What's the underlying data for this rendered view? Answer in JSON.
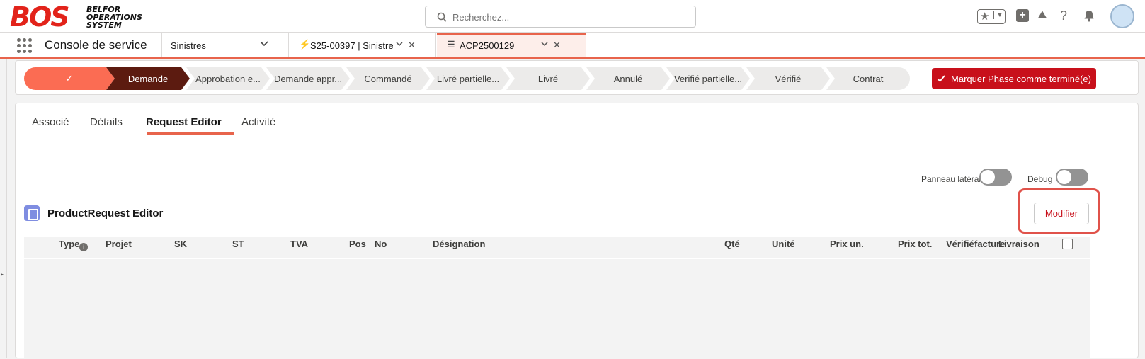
{
  "header": {
    "logo_text": "BOS",
    "logo_subtitle": "BELFOR OPERATIONS SYSTEM",
    "search_placeholder": "Recherchez...",
    "icons": [
      "star-icon",
      "plus-icon",
      "trailhead-icon",
      "help-icon",
      "bell-icon",
      "avatar"
    ]
  },
  "nav": {
    "app_name": "Console de service",
    "object_selector": "Sinistres",
    "tabs": [
      {
        "label": "S25-00397 | Sinistre",
        "icon": "bolt-icon",
        "active": false
      },
      {
        "label": "ACP2500129",
        "icon": "request-icon",
        "active": true
      }
    ]
  },
  "path": {
    "steps": [
      {
        "label": "✓",
        "state": "complete"
      },
      {
        "label": "Demande",
        "state": "current"
      },
      {
        "label": "Approbation e...",
        "state": "incomplete"
      },
      {
        "label": "Demande appr...",
        "state": "incomplete"
      },
      {
        "label": "Commandé",
        "state": "incomplete"
      },
      {
        "label": "Livré partielle...",
        "state": "incomplete"
      },
      {
        "label": "Livré",
        "state": "incomplete"
      },
      {
        "label": "Annulé",
        "state": "incomplete"
      },
      {
        "label": "Verifié partielle...",
        "state": "incomplete"
      },
      {
        "label": "Vérifié",
        "state": "incomplete"
      },
      {
        "label": "Contrat",
        "state": "incomplete"
      }
    ],
    "mark_button": "Marquer Phase comme terminé(e)"
  },
  "tabs": [
    {
      "label": "Associé",
      "active": false
    },
    {
      "label": "Détails",
      "active": false
    },
    {
      "label": "Request Editor",
      "active": true
    },
    {
      "label": "Activité",
      "active": false
    }
  ],
  "toggles": {
    "side_panel_label": "Panneau latéral",
    "side_panel_on": false,
    "debug_label": "Debug",
    "debug_on": false
  },
  "editor": {
    "title": "ProductRequest Editor",
    "edit_button": "Modifier",
    "columns": [
      "Type",
      "Projet",
      "SK",
      "ST",
      "TVA",
      "Pos",
      "No",
      "Désignation",
      "Qté",
      "Unité",
      "Prix un.",
      "Prix tot.",
      "Vérifié",
      "facture",
      "Livraison"
    ],
    "rows": []
  },
  "colors": {
    "accent": "#e8644c",
    "brand_red": "#c8101b",
    "path_complete": "#fb6c53",
    "path_current": "#5c1b10"
  }
}
